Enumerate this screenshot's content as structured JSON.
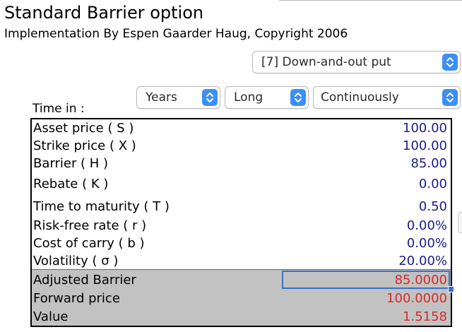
{
  "header": {
    "title": "Standard Barrier option",
    "subtitle": "Implementation By Espen Gaarder Haug, Copyright 2006"
  },
  "selectors": {
    "option_type": "[7] Down-and-out put",
    "time_unit": "Years",
    "position": "Long",
    "monitoring": "Continuously"
  },
  "time_in_label": "Time in :",
  "inputs": [
    {
      "label": "Asset price ( S )",
      "value": "100.00"
    },
    {
      "label": "Strike price ( X )",
      "value": "100.00"
    },
    {
      "label": "Barrier ( H )",
      "value": "85.00"
    },
    {
      "label": "Rebate ( K )",
      "value": "0.00"
    },
    {
      "label": "Time to maturity ( T )",
      "value": "0.50"
    },
    {
      "label": "Risk-free rate ( r )",
      "value": "0.00%"
    },
    {
      "label": "Cost of carry ( b )",
      "value": "0.00%"
    },
    {
      "label": "Volatility ( σ )",
      "value": "20.00%"
    }
  ],
  "outputs": [
    {
      "label": "Adjusted Barrier",
      "value": "85.0000"
    },
    {
      "label": "Forward price",
      "value": "100.0000"
    },
    {
      "label": "Value",
      "value": "1.5158"
    }
  ],
  "colors": {
    "input_value": "#1c1c8a",
    "output_value": "#d42a2a",
    "output_background": "#c2c2c2",
    "selection": "#3a6fc4",
    "stepper": "#3b8ff6"
  },
  "icons": {
    "stepper": "up-down-chevron-icon"
  }
}
